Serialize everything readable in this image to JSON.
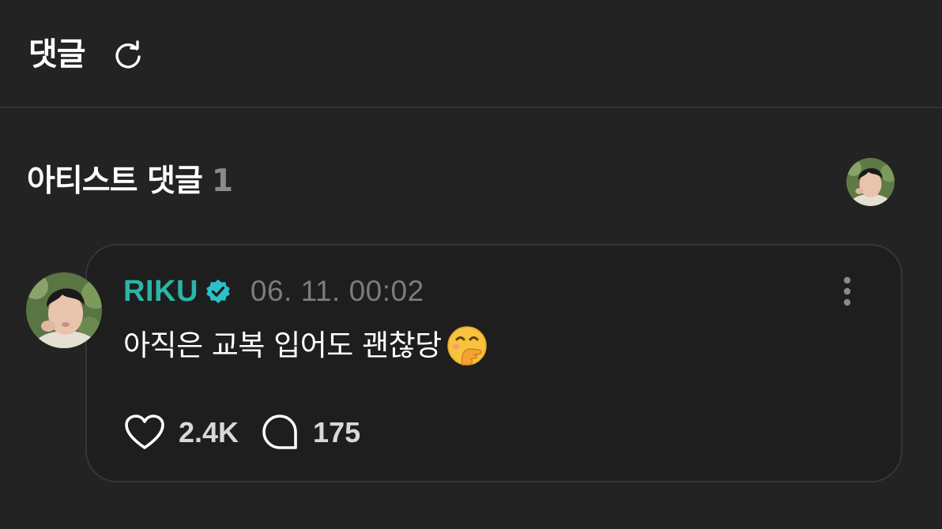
{
  "header": {
    "title": "댓글",
    "refresh_icon": "refresh-icon"
  },
  "section": {
    "title": "아티스트 댓글",
    "count": "1"
  },
  "comment": {
    "author": "RIKU",
    "timestamp": "06. 11. 00:02",
    "text": "아직은 교복 입어도 괜찮당",
    "emoji": "face-with-hand-over-mouth-emoji",
    "likes": "2.4K",
    "replies": "175"
  },
  "colors": {
    "background": "#232323",
    "card": "#1e1e1e",
    "accent": "#2bb5a6",
    "muted": "#7c7c7c"
  }
}
